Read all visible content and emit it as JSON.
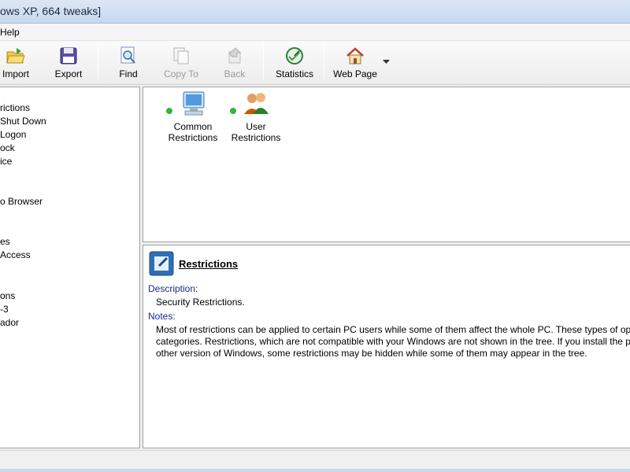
{
  "window": {
    "title": "ows XP, 664 tweaks]"
  },
  "menu": {
    "help": "Help"
  },
  "toolbar": {
    "import": "Import",
    "export": "Export",
    "find": "Find",
    "copy_to": "Copy To",
    "back": "Back",
    "statistics": "Statistics",
    "web_page": "Web Page"
  },
  "tree": {
    "items": [
      "rictions",
      "Shut Down",
      "Logon",
      "ock",
      "ice",
      "",
      "o Browser",
      "",
      "es",
      "Access",
      "",
      "ons",
      "-3",
      "ador"
    ]
  },
  "top_pane": {
    "common_restrictions": {
      "line1": "Common",
      "line2": "Restrictions"
    },
    "user_restrictions": {
      "line1": "User",
      "line2": "Restrictions"
    }
  },
  "details": {
    "title": "Restrictions",
    "description_label": "Description:",
    "description": "Security Restrictions.",
    "notes_label": "Notes:",
    "notes_lines": [
      "Most of restrictions can be applied to certain PC users while some of them affect the whole PC. These types of options a",
      "categories. Restrictions, which are not compatible with your Windows are not shown in the tree. If you install the program",
      "other version of Windows, some restrictions may be hidden while some of them may appear in the tree."
    ]
  },
  "colors": {
    "status_dot": "#35b43a",
    "title_bar": "#c7d9ef"
  }
}
